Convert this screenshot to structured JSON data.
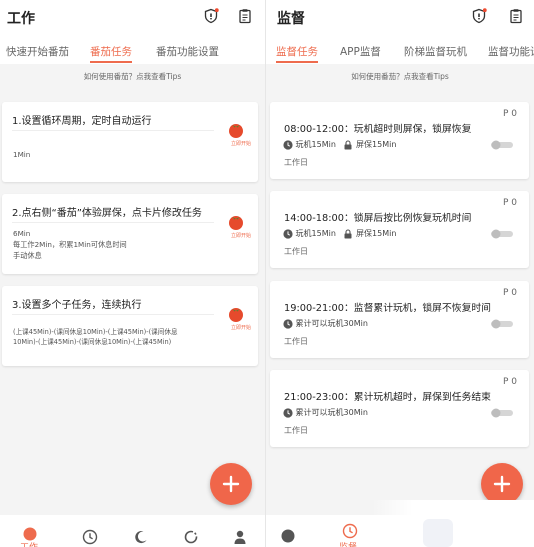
{
  "left": {
    "title": "工作",
    "tabs": [
      {
        "label": "快速开始番茄"
      },
      {
        "label": "番茄任务",
        "active": true
      },
      {
        "label": "番茄功能设置"
      }
    ],
    "tip": "如何使用番茄？点我查看Tips",
    "tasks": [
      {
        "title": "1.设置循环周期，定时自动运行",
        "desc": [
          "1Min"
        ],
        "start": "立即开始"
      },
      {
        "title": "2.点右侧“番茄”体验屏保，点卡片修改任务",
        "desc": [
          "6Min",
          "每工作2Min，积累1Min可休息时间",
          "手动休息"
        ],
        "start": "立即开始"
      },
      {
        "title": "3.设置多个子任务，连续执行",
        "desc": [
          "(上课45Min)-(课间休息10Min)-(上课45Min)-(课间休息",
          "10Min)-(上课45Min)-(课间休息10Min)-(上课45Min)"
        ],
        "start": "立即开始"
      }
    ],
    "bottom_label": "工作"
  },
  "right": {
    "title": "监督",
    "tabs": [
      {
        "label": "监督任务",
        "active": true
      },
      {
        "label": "APP监督"
      },
      {
        "label": "阶梯监督玩机"
      },
      {
        "label": "监督功能设"
      }
    ],
    "tip": "如何使用番茄？点我查看Tips",
    "rules": [
      {
        "time": "08:00-12:00：玩机超时则屏保，锁屏恢复",
        "p": "P 0",
        "meta": [
          {
            "icon": "clock-icon",
            "text": "玩机15Min"
          },
          {
            "icon": "lock-icon",
            "text": "屏保15Min"
          }
        ],
        "day": "工作日",
        "enabled": false
      },
      {
        "time": "14:00-18:00：锁屏后按比例恢复玩机时间",
        "p": "P 0",
        "meta": [
          {
            "icon": "clock-icon",
            "text": "玩机15Min"
          },
          {
            "icon": "lock-icon",
            "text": "屏保15Min"
          }
        ],
        "day": "工作日",
        "enabled": false
      },
      {
        "time": "19:00-21:00：监督累计玩机，锁屏不恢复时间",
        "p": "P 0",
        "meta": [
          {
            "icon": "clock-icon",
            "text": "累计可以玩机30Min"
          }
        ],
        "day": "工作日",
        "enabled": false
      },
      {
        "time": "21:00-23:00：累计玩机超时，屏保到任务结束",
        "p": "P 0",
        "meta": [
          {
            "icon": "clock-icon",
            "text": "累计可以玩机30Min"
          }
        ],
        "day": "工作日",
        "enabled": false
      }
    ],
    "bottom_label": "监督"
  },
  "colors": {
    "accent": "#ee6b4d",
    "fab": "#f0664a",
    "background": "#f4f4f4"
  }
}
